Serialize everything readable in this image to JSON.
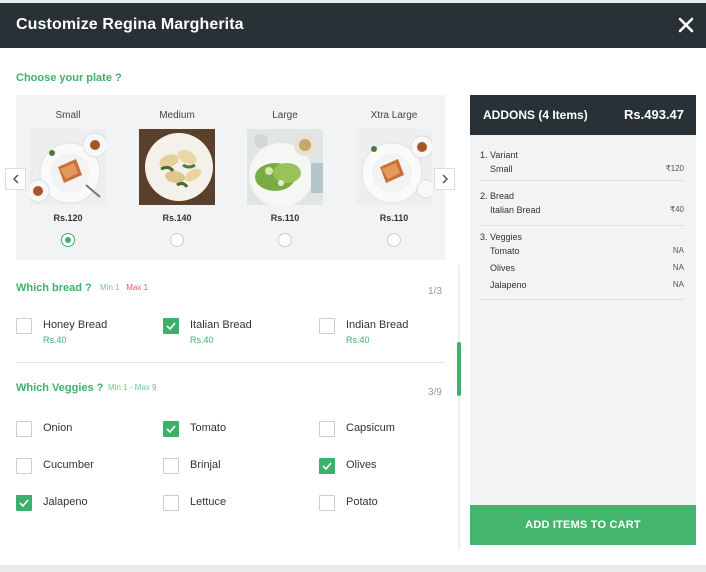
{
  "header": {
    "title": "Customize Regina Margherita"
  },
  "plate_section": {
    "title": "Choose your plate ?",
    "plates": [
      {
        "name": "Small",
        "price": "Rs.120",
        "selected": true
      },
      {
        "name": "Medium",
        "price": "Rs.140",
        "selected": false
      },
      {
        "name": "Large",
        "price": "Rs.110",
        "selected": false
      },
      {
        "name": "Xtra Large",
        "price": "Rs.110",
        "selected": false
      }
    ]
  },
  "bread_section": {
    "title": "Which bread ?",
    "min": "Min 1",
    "max": "Max 1",
    "count": "1/3",
    "options": [
      {
        "label": "Honey Bread",
        "price": "Rs.40",
        "checked": false
      },
      {
        "label": "Italian Bread",
        "price": "Rs.40",
        "checked": true
      },
      {
        "label": "Indian Bread",
        "price": "Rs.40",
        "checked": false
      }
    ]
  },
  "veggies_section": {
    "title": "Which Veggies ?",
    "minmax": "Min 1 - Max 9",
    "count": "3/9",
    "options": [
      {
        "label": "Onion",
        "checked": false
      },
      {
        "label": "Tomato",
        "checked": true
      },
      {
        "label": "Capsicum",
        "checked": false
      },
      {
        "label": "Cucumber",
        "checked": false
      },
      {
        "label": "Brinjal",
        "checked": false
      },
      {
        "label": "Olives",
        "checked": true
      },
      {
        "label": "Jalapeno",
        "checked": true
      },
      {
        "label": "Lettuce",
        "checked": false
      },
      {
        "label": "Potato",
        "checked": false
      }
    ]
  },
  "summary": {
    "title": "ADDONS (4 Items)",
    "total": "Rs.493.47",
    "groups": [
      {
        "heading": "1. Variant",
        "rows": [
          {
            "name": "Small",
            "value": "₹120"
          }
        ]
      },
      {
        "heading": "2. Bread",
        "rows": [
          {
            "name": "Italian Bread",
            "value": "₹40"
          }
        ]
      },
      {
        "heading": "3. Veggies",
        "rows": [
          {
            "name": "Tomato",
            "value": "NA"
          },
          {
            "name": "Olives",
            "value": "NA"
          },
          {
            "name": "Jalapeno",
            "value": "NA"
          }
        ]
      }
    ],
    "cart_button": "ADD ITEMS TO CART"
  },
  "icons": {
    "close": "close-icon",
    "prev": "chevron-left-icon",
    "next": "chevron-right-icon",
    "check": "checkmark-icon"
  },
  "colors": {
    "header_bg": "#283136",
    "accent_green": "#3db16b",
    "max_red": "#ef5a5a",
    "cart_button_bg": "#44b56c"
  }
}
